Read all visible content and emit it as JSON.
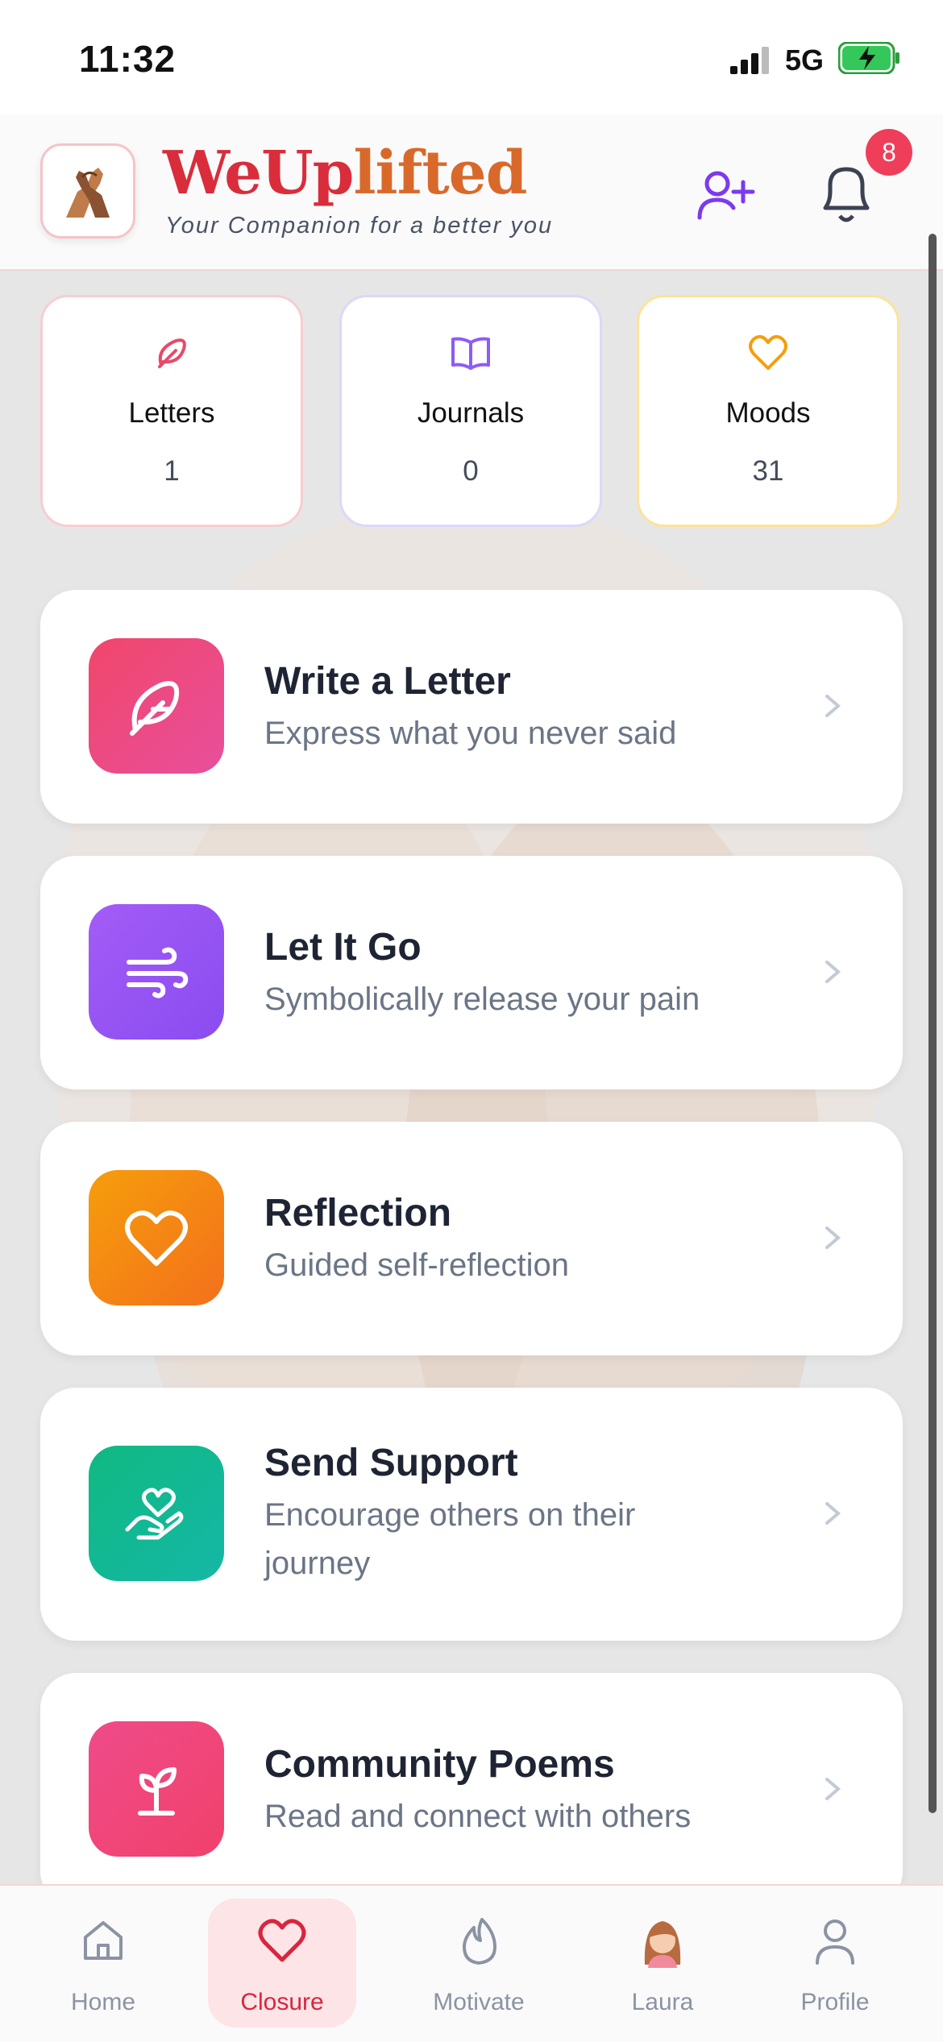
{
  "status_bar": {
    "time": "11:32",
    "network": "5G"
  },
  "header": {
    "title_part1": "WeUp",
    "title_part2": "lifted",
    "tagline": "Your Companion for a better you",
    "notification_count": "8"
  },
  "stats": [
    {
      "label": "Letters",
      "value": "1",
      "icon": "feather-icon",
      "color": "#e84a6a"
    },
    {
      "label": "Journals",
      "value": "0",
      "icon": "book-open-icon",
      "color": "#8b5cf6"
    },
    {
      "label": "Moods",
      "value": "31",
      "icon": "heart-icon",
      "color": "#f59e0b"
    }
  ],
  "features": [
    {
      "title": "Write a Letter",
      "subtitle": "Express what you never said",
      "icon": "feather-icon",
      "color": "#ec4f7c"
    },
    {
      "title": "Let It Go",
      "subtitle": "Symbolically release your pain",
      "icon": "wind-icon",
      "color": "#9b5cf6"
    },
    {
      "title": "Reflection",
      "subtitle": "Guided self-reflection",
      "icon": "heart-icon",
      "color": "#f58a12"
    },
    {
      "title": "Send Support",
      "subtitle": "Encourage others on their journey",
      "icon": "hand-heart-icon",
      "color": "#17b893"
    },
    {
      "title": "Community Poems",
      "subtitle": "Read and connect with others",
      "icon": "sprout-icon",
      "color": "#ee4a86"
    }
  ],
  "tabs": [
    {
      "label": "Home",
      "icon": "home-icon"
    },
    {
      "label": "Closure",
      "icon": "heart-icon",
      "active": true
    },
    {
      "label": "Motivate",
      "icon": "flame-icon"
    },
    {
      "label": "Laura",
      "icon": "avatar-icon"
    },
    {
      "label": "Profile",
      "icon": "user-icon"
    }
  ],
  "colors": {
    "accent": "#d92d3c",
    "accent_alt": "#d9692a",
    "purple": "#7c3aed",
    "tab_active_bg": "#fde4e6"
  }
}
